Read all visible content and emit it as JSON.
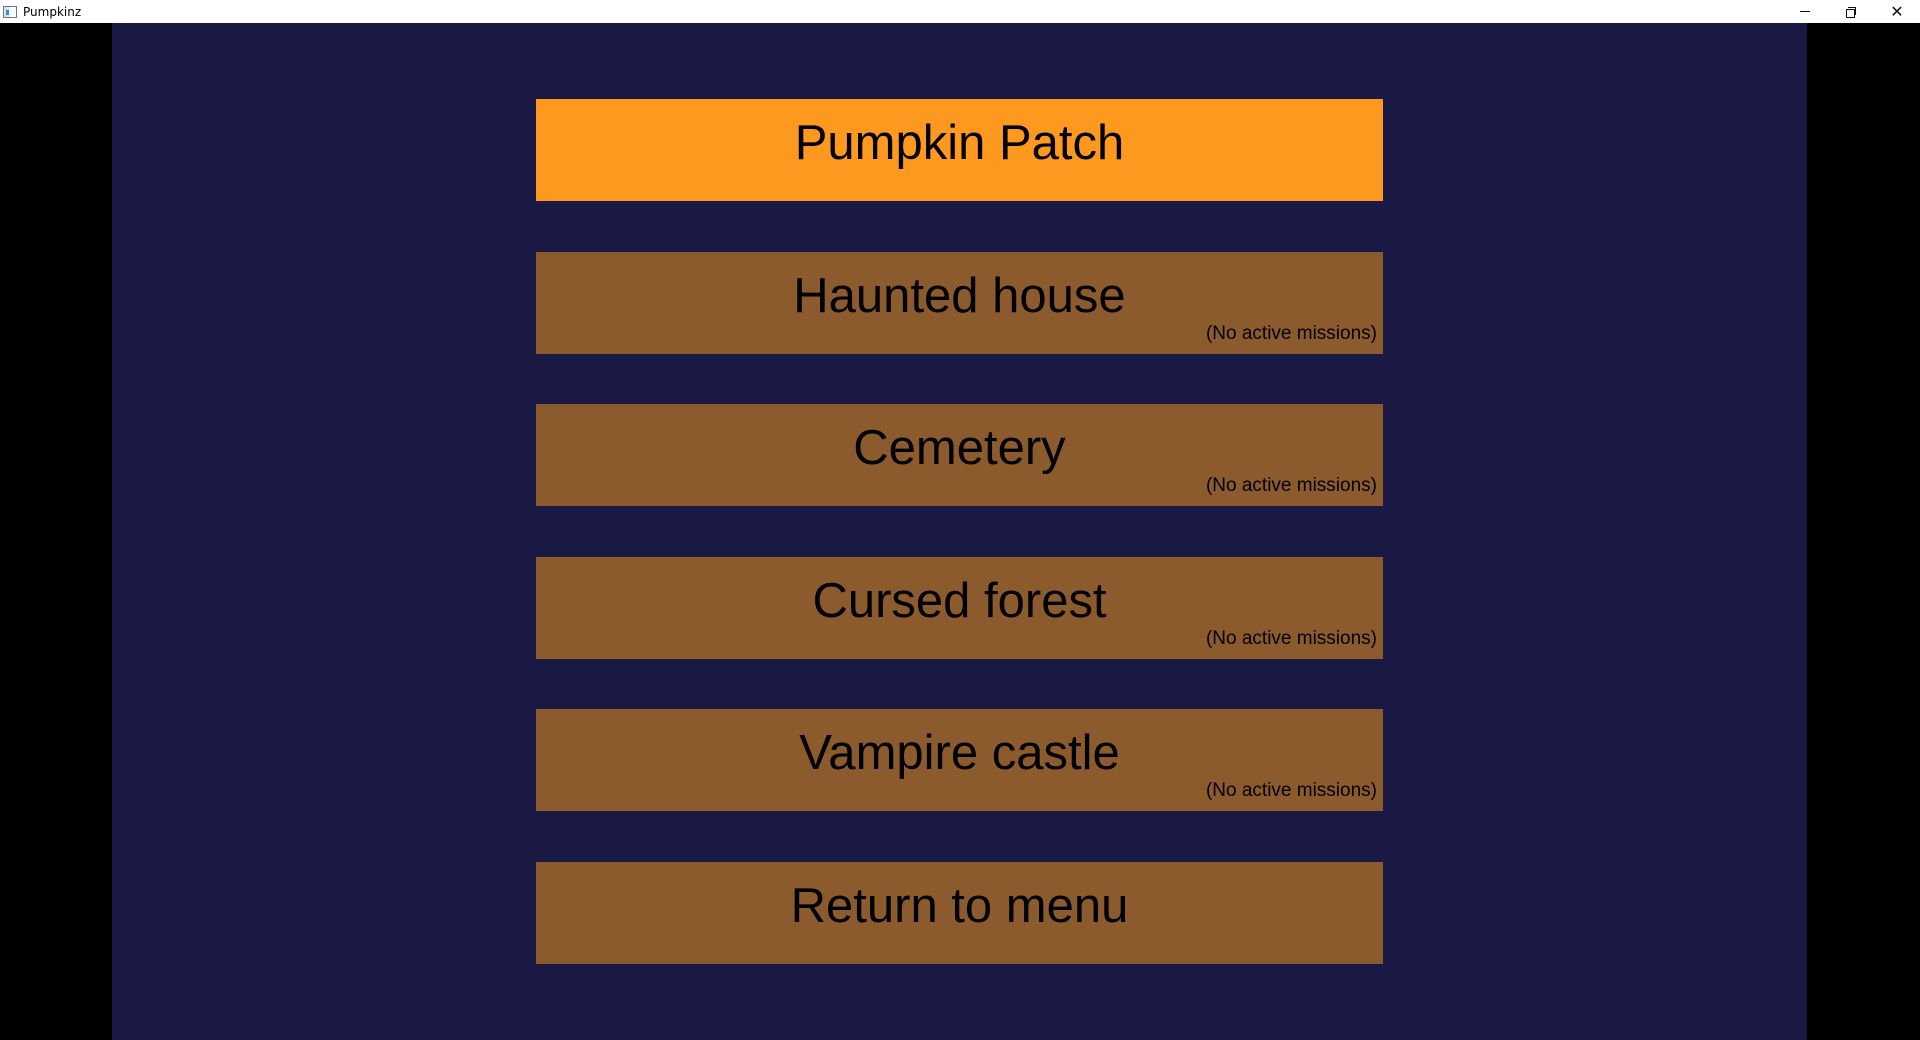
{
  "window": {
    "title": "Pumpkinz",
    "minimize": "–",
    "restore": "❐",
    "close": "✕"
  },
  "levels": [
    {
      "label": "Pumpkin Patch",
      "status": "",
      "selected": true
    },
    {
      "label": "Haunted house",
      "status": "(No active missions)",
      "selected": false
    },
    {
      "label": "Cemetery",
      "status": "(No active missions)",
      "selected": false
    },
    {
      "label": "Cursed forest",
      "status": "(No active missions)",
      "selected": false
    },
    {
      "label": "Vampire castle",
      "status": "(No active missions)",
      "selected": false
    }
  ],
  "return_button": {
    "label": "Return to menu"
  },
  "colors": {
    "background": "#1a1943",
    "button": "#8b5a2d",
    "button_selected": "#fe991f",
    "letterbox": "#000000"
  }
}
